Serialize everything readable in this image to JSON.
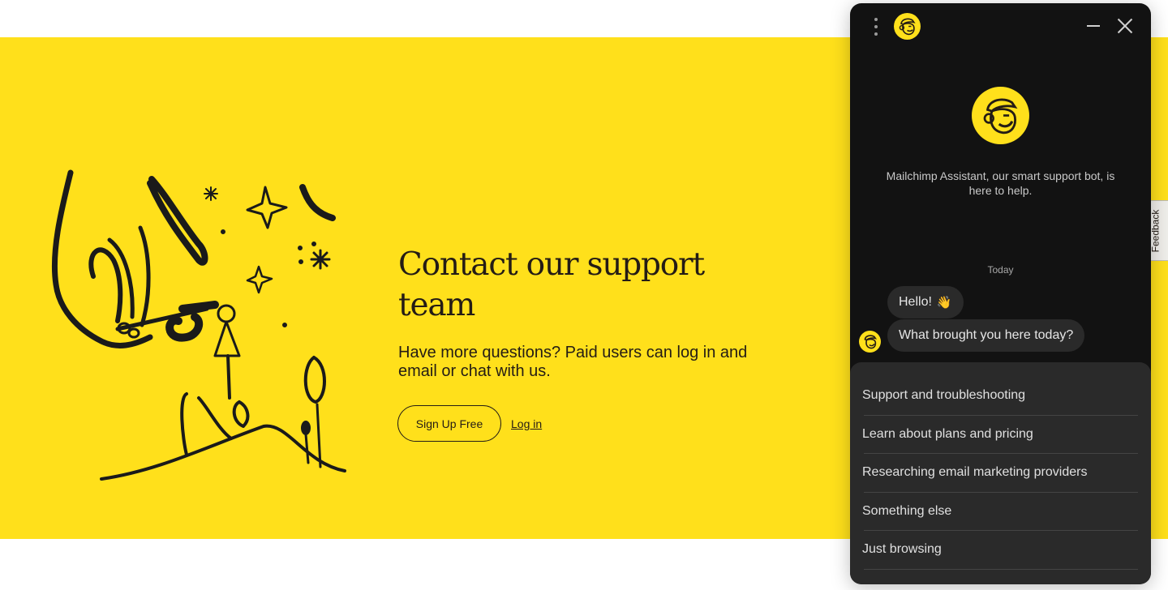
{
  "hero": {
    "title": "Contact our support team",
    "subtitle": "Have more questions? Paid users can log in and email or chat with us.",
    "signup_label": "Sign Up Free",
    "login_label": "Log in",
    "background_color": "#ffe01b",
    "illustration": "hand-drawn-hand-and-people-illustration"
  },
  "feedback_tab": {
    "label": "Feedback"
  },
  "chat": {
    "header": {
      "menu_icon": "more-vertical-icon",
      "logo_icon": "mailchimp-freddie-icon",
      "minimize_icon": "minimize-icon",
      "close_icon": "close-icon"
    },
    "intro": "Mailchimp Assistant, our smart support bot, is here to help.",
    "date_separator": "Today",
    "messages": [
      {
        "text": "Hello!",
        "emoji": "👋"
      },
      {
        "text": "What brought you here today?"
      }
    ],
    "options": [
      {
        "label": "Support and troubleshooting"
      },
      {
        "label": "Learn about plans and pricing"
      },
      {
        "label": "Researching email marketing providers"
      },
      {
        "label": "Something else"
      },
      {
        "label": "Just browsing"
      }
    ],
    "accent_color": "#ffe01b",
    "background_color": "#121212"
  }
}
